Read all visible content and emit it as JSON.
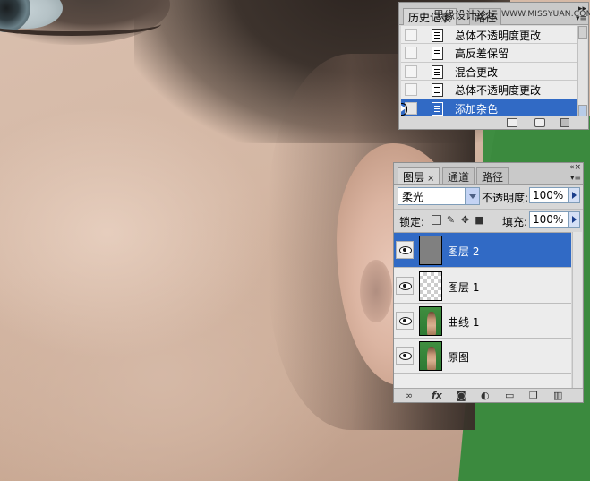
{
  "history_panel": {
    "tabs": [
      "历史记录",
      "路径"
    ],
    "items": [
      {
        "label": "总体不透明度更改",
        "selected": false
      },
      {
        "label": "高反差保留",
        "selected": false
      },
      {
        "label": "混合更改",
        "selected": false
      },
      {
        "label": "总体不透明度更改",
        "selected": false
      },
      {
        "label": "添加杂色",
        "selected": true
      }
    ],
    "footer_icons": [
      "new-document-from-state-icon",
      "snapshot-camera-icon",
      "trash-icon"
    ]
  },
  "watermark": {
    "text": "思缘设计论坛",
    "url": "WWW.MISSYUAN.COM"
  },
  "layers_panel": {
    "tabs": [
      "图层",
      "通道",
      "路径"
    ],
    "blend_mode": "柔光",
    "opacity_label": "不透明度:",
    "opacity_value": "100%",
    "lock_label": "锁定:",
    "fill_label": "填充:",
    "fill_value": "100%",
    "layers": [
      {
        "name": "图层 2",
        "thumb": "gray",
        "visible": true,
        "selected": true
      },
      {
        "name": "图层 1",
        "thumb": "transparent",
        "visible": true,
        "selected": false
      },
      {
        "name": "曲线 1",
        "thumb": "photo",
        "visible": true,
        "selected": false
      },
      {
        "name": "原图",
        "thumb": "photo",
        "visible": true,
        "selected": false
      }
    ],
    "footer_icons": [
      "link-icon",
      "fx-icon",
      "mask-icon",
      "adjustment-icon",
      "folder-icon",
      "new-layer-icon",
      "trash-icon"
    ],
    "fx_text": "fx"
  },
  "colors": {
    "selection": "#316ac5",
    "panel_bg": "#d7d7d7",
    "background_green": "#3b8a3e"
  }
}
